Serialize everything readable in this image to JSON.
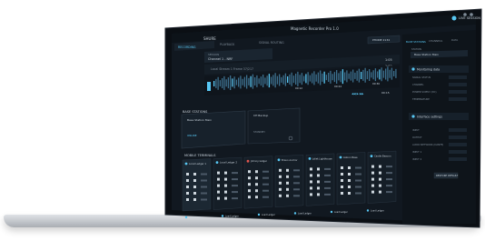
{
  "app": {
    "window_title": "Magnetic Recorder Pro 1.0",
    "top_tabs": [
      "RECORDING",
      "PLAYBACK",
      "SIGNAL ROUTING"
    ],
    "top_right": "LIVE SESSION",
    "phone_label": "PHONE 2134"
  },
  "header_fields": {
    "session_label": "SESSION",
    "session_value": "Channel 1 - NRF",
    "sub_value": "Local Stream 1 Frame 37/217",
    "time_a": "1:05",
    "time_b": "1:02"
  },
  "waveform": {
    "markers": [
      "00:12",
      "00:24",
      "00:36"
    ],
    "counter": "00:15"
  },
  "base_stations": {
    "title": "BASE STATIONS",
    "cards": [
      {
        "name": "Base Station Main",
        "status": "ONLINE"
      },
      {
        "name": "CH Backup",
        "status": "STANDBY"
      }
    ]
  },
  "mobile_terminals": {
    "title": "MOBILE TERMINALS",
    "items": [
      {
        "name": "Local Ledger 1"
      },
      {
        "name": "Local Ledger 2"
      },
      {
        "name": "Johnny ledger"
      },
      {
        "name": "Bravo Anchor"
      },
      {
        "name": "Juliet Lighthouse"
      },
      {
        "name": "Lisbon Base"
      },
      {
        "name": "Castle Beacon"
      }
    ],
    "footer_items": [
      "Load Ledger",
      "Load Ledger",
      "Load Ledger",
      "Load Ledger",
      "Load Ledger",
      "Load Ledger"
    ]
  },
  "right_panel": {
    "tabs": [
      "BASE STATIONS",
      "CHANNELS",
      "DATA"
    ],
    "name_label": "STATION",
    "name_value": "Base Station Main",
    "sections": [
      {
        "title": "Monitoring data",
        "fields": [
          "SIGNAL STATUS",
          "CHANNEL",
          "POWER SUPPLY (DC)",
          "TEMPERATURE"
        ]
      },
      {
        "title": "Interface settings",
        "button": "RESTORE DEFAULT",
        "fields": [
          "INPUT",
          "OUTPUT",
          "AUDIO NETWORK (DANTE)",
          "INPUT 1",
          "INPUT 2"
        ]
      }
    ]
  }
}
